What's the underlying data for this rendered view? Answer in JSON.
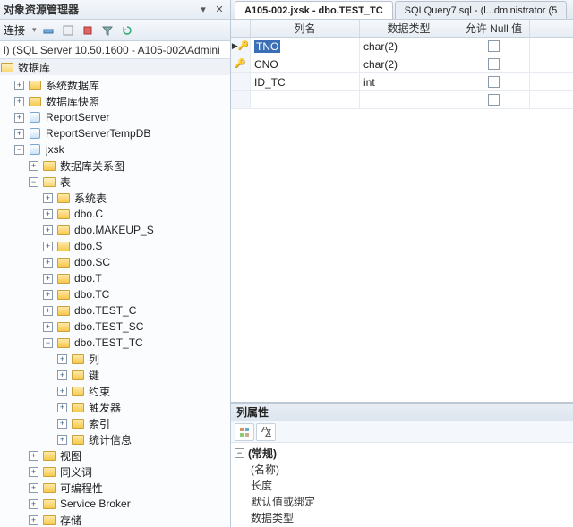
{
  "left": {
    "title": "对象资源管理器",
    "connect_label": "连接",
    "server_line": "l) (SQL Server 10.50.1600 - A105-002\\Admini",
    "section_db": "数据库",
    "nodes": [
      {
        "label": "系统数据库",
        "icon": "folder",
        "exp": "+",
        "ind": 1
      },
      {
        "label": "数据库快照",
        "icon": "folder",
        "exp": "+",
        "ind": 1
      },
      {
        "label": "ReportServer",
        "icon": "db",
        "exp": "+",
        "ind": 1
      },
      {
        "label": "ReportServerTempDB",
        "icon": "db",
        "exp": "+",
        "ind": 1
      },
      {
        "label": "jxsk",
        "icon": "db",
        "exp": "-",
        "ind": 1
      },
      {
        "label": "数据库关系图",
        "icon": "folder",
        "exp": "+",
        "ind": 2
      },
      {
        "label": "表",
        "icon": "folder-open",
        "exp": "-",
        "ind": 2
      },
      {
        "label": "系统表",
        "icon": "folder",
        "exp": "+",
        "ind": 3
      },
      {
        "label": "dbo.C",
        "icon": "folder",
        "exp": "+",
        "ind": 3
      },
      {
        "label": "dbo.MAKEUP_S",
        "icon": "folder",
        "exp": "+",
        "ind": 3
      },
      {
        "label": "dbo.S",
        "icon": "folder",
        "exp": "+",
        "ind": 3
      },
      {
        "label": "dbo.SC",
        "icon": "folder",
        "exp": "+",
        "ind": 3
      },
      {
        "label": "dbo.T",
        "icon": "folder",
        "exp": "+",
        "ind": 3
      },
      {
        "label": "dbo.TC",
        "icon": "folder",
        "exp": "+",
        "ind": 3
      },
      {
        "label": "dbo.TEST_C",
        "icon": "folder",
        "exp": "+",
        "ind": 3
      },
      {
        "label": "dbo.TEST_SC",
        "icon": "folder",
        "exp": "+",
        "ind": 3
      },
      {
        "label": "dbo.TEST_TC",
        "icon": "folder",
        "exp": "-",
        "ind": 3
      },
      {
        "label": "列",
        "icon": "folder",
        "exp": "+",
        "ind": 4
      },
      {
        "label": "键",
        "icon": "folder",
        "exp": "+",
        "ind": 4
      },
      {
        "label": "约束",
        "icon": "folder",
        "exp": "+",
        "ind": 4
      },
      {
        "label": "触发器",
        "icon": "folder",
        "exp": "+",
        "ind": 4
      },
      {
        "label": "索引",
        "icon": "folder",
        "exp": "+",
        "ind": 4
      },
      {
        "label": "统计信息",
        "icon": "folder",
        "exp": "+",
        "ind": 4
      },
      {
        "label": "视图",
        "icon": "folder",
        "exp": "+",
        "ind": 2
      },
      {
        "label": "同义词",
        "icon": "folder",
        "exp": "+",
        "ind": 2
      },
      {
        "label": "可编程性",
        "icon": "folder",
        "exp": "+",
        "ind": 2
      },
      {
        "label": "Service Broker",
        "icon": "folder",
        "exp": "+",
        "ind": 2
      },
      {
        "label": "存储",
        "icon": "folder",
        "exp": "+",
        "ind": 2
      }
    ]
  },
  "tabs": [
    {
      "label": "A105-002.jxsk - dbo.TEST_TC",
      "active": true
    },
    {
      "label": "SQLQuery7.sql - (l...dministrator (5",
      "active": false
    }
  ],
  "grid": {
    "headers": {
      "name": "列名",
      "type": "数据类型",
      "null": "允许 Null 值"
    },
    "rows": [
      {
        "key": true,
        "name": "TNO",
        "type": "char(2)",
        "selected": true
      },
      {
        "key": true,
        "name": "CNO",
        "type": "char(2)",
        "selected": false
      },
      {
        "key": false,
        "name": "ID_TC",
        "type": "int",
        "selected": false
      }
    ]
  },
  "props": {
    "title": "列属性",
    "category": "(常规)",
    "items": [
      "(名称)",
      "长度",
      "默认值或绑定",
      "数据类型"
    ]
  }
}
